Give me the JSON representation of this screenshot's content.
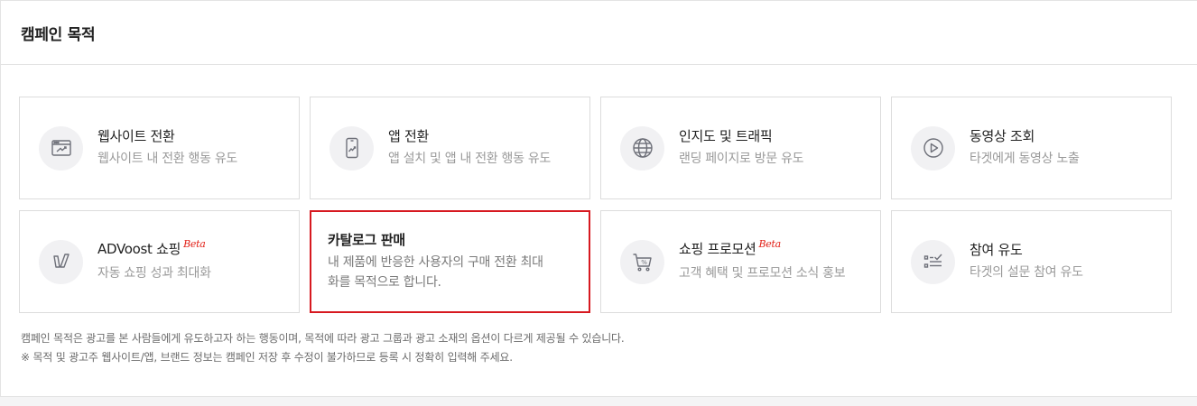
{
  "panel": {
    "title": "캠페인 목적"
  },
  "cards": [
    {
      "title": "웹사이트 전환",
      "desc": "웹사이트 내 전환 행동 유도",
      "icon": "website-conversion-icon",
      "beta": ""
    },
    {
      "title": "앱 전환",
      "desc": "앱 설치 및 앱 내 전환 행동 유도",
      "icon": "app-conversion-icon",
      "beta": ""
    },
    {
      "title": "인지도 및 트래픽",
      "desc": "랜딩 페이지로 방문 유도",
      "icon": "globe-icon",
      "beta": ""
    },
    {
      "title": "동영상 조회",
      "desc": "타겟에게 동영상 노출",
      "icon": "play-icon",
      "beta": ""
    },
    {
      "title": "ADVoost 쇼핑",
      "desc": "자동 쇼핑 성과 최대화",
      "icon": "advoost-icon",
      "beta": "Beta"
    },
    {
      "title": "카탈로그 판매",
      "desc": "내 제품에 반응한 사용자의 구매 전환 최대화를 목적으로 합니다.",
      "icon": "",
      "beta": ""
    },
    {
      "title": "쇼핑 프로모션",
      "desc": "고객 혜택 및 프로모션 소식 홍보",
      "icon": "cart-percent-icon",
      "beta": "Beta"
    },
    {
      "title": "참여 유도",
      "desc": "타겟의 설문 참여 유도",
      "icon": "checklist-icon",
      "beta": ""
    }
  ],
  "selected_card": "카탈로그 판매",
  "notes": {
    "line1": "캠페인 목적은 광고를 본 사람들에게 유도하고자 하는 행동이며, 목적에 따라 광고 그룹과 광고 소재의 옵션이 다르게 제공될 수 있습니다.",
    "line2": "※ 목적 및 광고주 웹사이트/앱, 브랜드 정보는 캠페인 저장 후 수정이 불가하므로 등록 시 정확히 입력해 주세요."
  },
  "colors": {
    "accent_red": "#d71920",
    "beta_red": "#e2231a",
    "border": "#dcdcdc",
    "icon_bg": "#f1f1f3"
  }
}
